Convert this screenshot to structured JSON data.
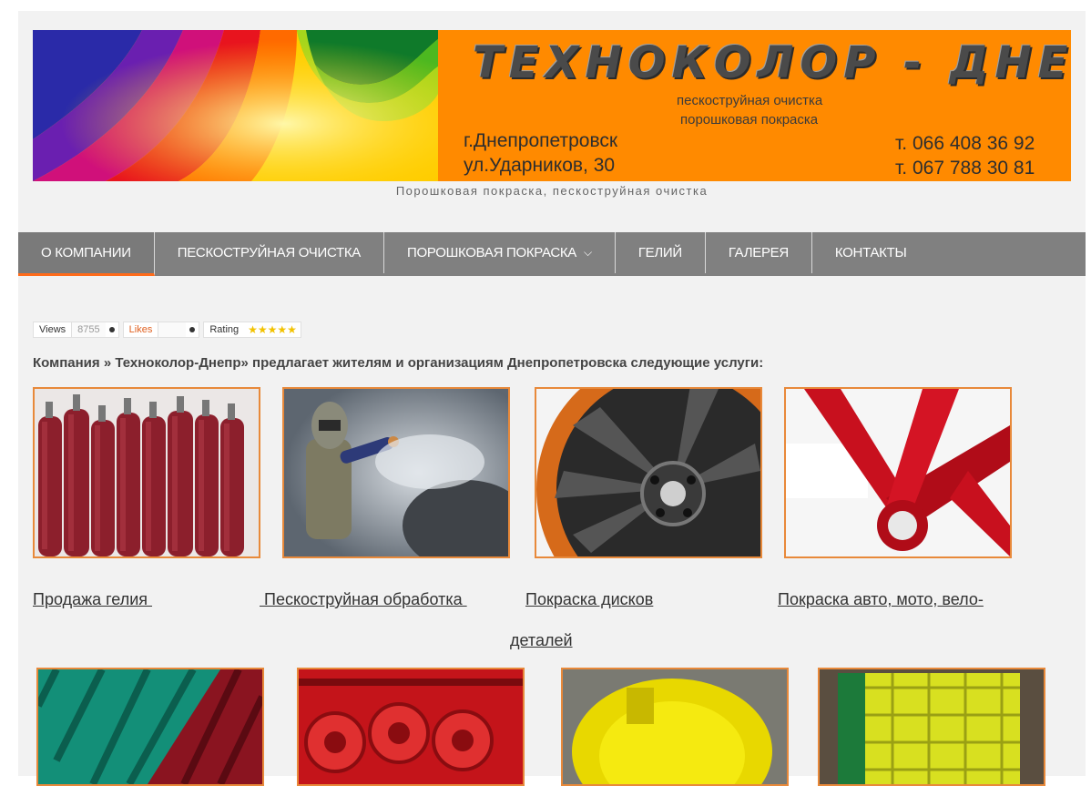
{
  "header": {
    "logo": "ТЕХНОКОЛОР - ДНЕПР",
    "services": [
      "пескоструйная очистка",
      "порошковая покраска"
    ],
    "city": "г.Днепропетровск",
    "street": "ул.Ударников, 30",
    "phones": [
      "т. 066 408 36 92",
      "т. 067 788 30 81"
    ],
    "tagline": "Порошковая покраска, пескоструйная очистка"
  },
  "nav": {
    "items": [
      "О КОМПАНИИ",
      "ПЕСКОСТРУЙНАЯ ОЧИСТКА",
      "ПОРОШКОВАЯ ПОКРАСКА",
      "ГЕЛИЙ",
      "ГАЛЕРЕЯ",
      "КОНТАКТЫ"
    ],
    "chevron": "⌄"
  },
  "stats": {
    "views_label": "Views",
    "views_value": "8755",
    "likes_label": "Likes",
    "rating_label": "Rating",
    "stars": "★★★★★"
  },
  "intro": "Компания » Технoколор-Днепр» предлагает жителям и организациям Днепропетровска следующие услуги:",
  "services": {
    "helium": "Продажа гелия ",
    "sandblast": " Пескоструйная обработка ",
    "wheels": "Покраска дисков",
    "auto_line1": "Покраска авто, мото, вело-",
    "auto_line2": "деталей"
  },
  "colors": {
    "accent": "#ff6b1a",
    "banner_orange": "#ff8a00",
    "nav_bg": "#808080",
    "photo_border": "#e8893a"
  }
}
